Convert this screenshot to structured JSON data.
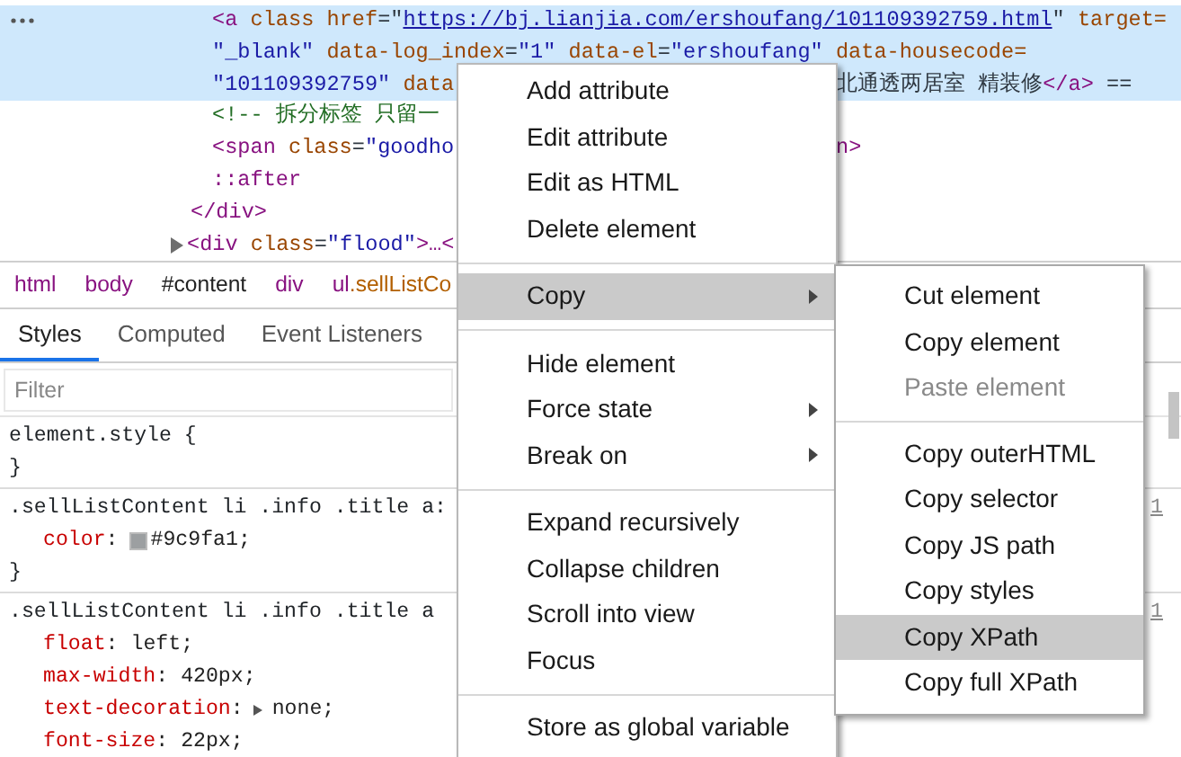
{
  "dom_tree": [
    {
      "selected": false,
      "collapsed": false,
      "children": [
        {
          "selected": true,
          "lines": [
            {
              "left": [
                {
                  "kind": "tag",
                  "text": "<a"
                },
                {
                  "kind": "attr",
                  "text": " class"
                },
                {
                  "kind": "attr",
                  "text": " href"
                },
                {
                  "kind": "punct",
                  "text": "=\""
                },
                {
                  "kind": "link",
                  "text": "https://bj.lianjia.com/ershoufang/101109392759.html"
                },
                {
                  "kind": "punct",
                  "text": "\""
                },
                {
                  "kind": "attr",
                  "text": " target="
                }
              ]
            },
            {
              "left": [
                {
                  "kind": "value",
                  "text": "\"_blank\""
                },
                {
                  "kind": "attr",
                  "text": " data-log_index"
                },
                {
                  "kind": "punct",
                  "text": "="
                },
                {
                  "kind": "value",
                  "text": "\"1\""
                },
                {
                  "kind": "attr",
                  "text": " data-el"
                },
                {
                  "kind": "punct",
                  "text": "="
                },
                {
                  "kind": "value",
                  "text": "\"ershoufang\""
                },
                {
                  "kind": "attr",
                  "text": " data-housecode="
                }
              ]
            },
            {
              "left": [
                {
                  "kind": "value",
                  "text": "\"101109392759\""
                },
                {
                  "kind": "attr",
                  "text": " data"
                }
              ],
              "right": [
                {
                  "kind": "text",
                  "text": "北通透两居室 精装修"
                },
                {
                  "kind": "tag",
                  "text": "</a>"
                },
                {
                  "kind": "punct",
                  "text": " =="
                }
              ]
            }
          ]
        },
        {
          "selected": false,
          "lines": [
            {
              "left": [
                {
                  "kind": "comment",
                  "text": "<!-- 拆分标签 只留一"
                }
              ]
            }
          ]
        },
        {
          "selected": false,
          "lines": [
            {
              "left": [
                {
                  "kind": "tag",
                  "text": "<span"
                },
                {
                  "kind": "attr",
                  "text": " class"
                },
                {
                  "kind": "punct",
                  "text": "="
                },
                {
                  "kind": "value",
                  "text": "\"goodho"
                }
              ],
              "right": [
                {
                  "kind": "tag",
                  "text": "n>"
                }
              ]
            }
          ]
        },
        {
          "selected": false,
          "lines": [
            {
              "left": [
                {
                  "kind": "tag",
                  "text": "::after"
                }
              ]
            }
          ]
        }
      ],
      "closing": {
        "left": [
          {
            "kind": "tag",
            "text": "</div>"
          }
        ]
      }
    },
    {
      "selected": false,
      "collapsed": true,
      "lines": [
        {
          "left": [
            {
              "kind": "tag",
              "text": "<div"
            },
            {
              "kind": "attr",
              "text": " class"
            },
            {
              "kind": "punct",
              "text": "="
            },
            {
              "kind": "value",
              "text": "\"flood\""
            },
            {
              "kind": "tag",
              "text": ">…<"
            }
          ]
        }
      ]
    }
  ],
  "breadcrumbs": [
    {
      "label": "html",
      "kind": "tag"
    },
    {
      "label": "body",
      "kind": "tag"
    },
    {
      "label": "#content",
      "kind": "id"
    },
    {
      "label": "div",
      "kind": "tag"
    },
    {
      "label": "ul.sellListCo",
      "kind": "class"
    }
  ],
  "tabs": [
    {
      "label": "Styles",
      "selected": true
    },
    {
      "label": "Computed",
      "selected": false
    },
    {
      "label": "Event Listeners",
      "selected": false
    }
  ],
  "filter": {
    "placeholder": "Filter"
  },
  "rules": [
    {
      "selector": "element.style {",
      "closing": "}"
    },
    {
      "selector": ".sellListContent li .info .title a:",
      "source": "1",
      "properties": [
        {
          "name": "color",
          "sep": ":",
          "value": "#9c9fa1;",
          "swatch": true,
          "expandable": false
        }
      ],
      "closing": "}"
    },
    {
      "selector": ".sellListContent li .info .title a",
      "source": "1",
      "properties": [
        {
          "name": "float",
          "sep": ":",
          "value": "left;",
          "swatch": false,
          "expandable": false
        },
        {
          "name": "max-width",
          "sep": ":",
          "value": "420px;",
          "swatch": false,
          "expandable": false
        },
        {
          "name": "text-decoration",
          "sep": ":",
          "value": "none;",
          "swatch": false,
          "expandable": true
        },
        {
          "name": "font-size",
          "sep": ":",
          "value": "22px;",
          "swatch": false,
          "expandable": false
        }
      ]
    }
  ],
  "context_menu": {
    "items": [
      {
        "kind": "item",
        "label": "Add attribute",
        "selected": false,
        "has_submenu": false
      },
      {
        "kind": "item",
        "label": "Edit attribute",
        "selected": false,
        "has_submenu": false
      },
      {
        "kind": "item",
        "label": "Edit as HTML",
        "selected": false,
        "has_submenu": false
      },
      {
        "kind": "item",
        "label": "Delete element",
        "selected": false,
        "has_submenu": false
      },
      {
        "kind": "separator"
      },
      {
        "kind": "item",
        "label": "Copy",
        "selected": true,
        "has_submenu": true
      },
      {
        "kind": "separator"
      },
      {
        "kind": "item",
        "label": "Hide element",
        "selected": false,
        "has_submenu": false
      },
      {
        "kind": "item",
        "label": "Force state",
        "selected": false,
        "has_submenu": true
      },
      {
        "kind": "item",
        "label": "Break on",
        "selected": false,
        "has_submenu": true
      },
      {
        "kind": "separator"
      },
      {
        "kind": "item",
        "label": "Expand recursively",
        "selected": false,
        "has_submenu": false
      },
      {
        "kind": "item",
        "label": "Collapse children",
        "selected": false,
        "has_submenu": false
      },
      {
        "kind": "item",
        "label": "Scroll into view",
        "selected": false,
        "has_submenu": false
      },
      {
        "kind": "item",
        "label": "Focus",
        "selected": false,
        "has_submenu": false
      },
      {
        "kind": "separator"
      },
      {
        "kind": "item",
        "label": "Store as global variable",
        "selected": false,
        "has_submenu": false
      }
    ],
    "submenu": {
      "items": [
        {
          "kind": "item",
          "label": "Cut element",
          "selected": false,
          "disabled": false
        },
        {
          "kind": "item",
          "label": "Copy element",
          "selected": false,
          "disabled": false
        },
        {
          "kind": "item",
          "label": "Paste element",
          "selected": false,
          "disabled": true
        },
        {
          "kind": "separator"
        },
        {
          "kind": "item",
          "label": "Copy outerHTML",
          "selected": false,
          "disabled": false
        },
        {
          "kind": "item",
          "label": "Copy selector",
          "selected": false,
          "disabled": false
        },
        {
          "kind": "item",
          "label": "Copy JS path",
          "selected": false,
          "disabled": false
        },
        {
          "kind": "item",
          "label": "Copy styles",
          "selected": false,
          "disabled": false
        },
        {
          "kind": "item",
          "label": "Copy XPath",
          "selected": true,
          "disabled": false
        },
        {
          "kind": "item",
          "label": "Copy full XPath",
          "selected": false,
          "disabled": false
        }
      ]
    }
  }
}
